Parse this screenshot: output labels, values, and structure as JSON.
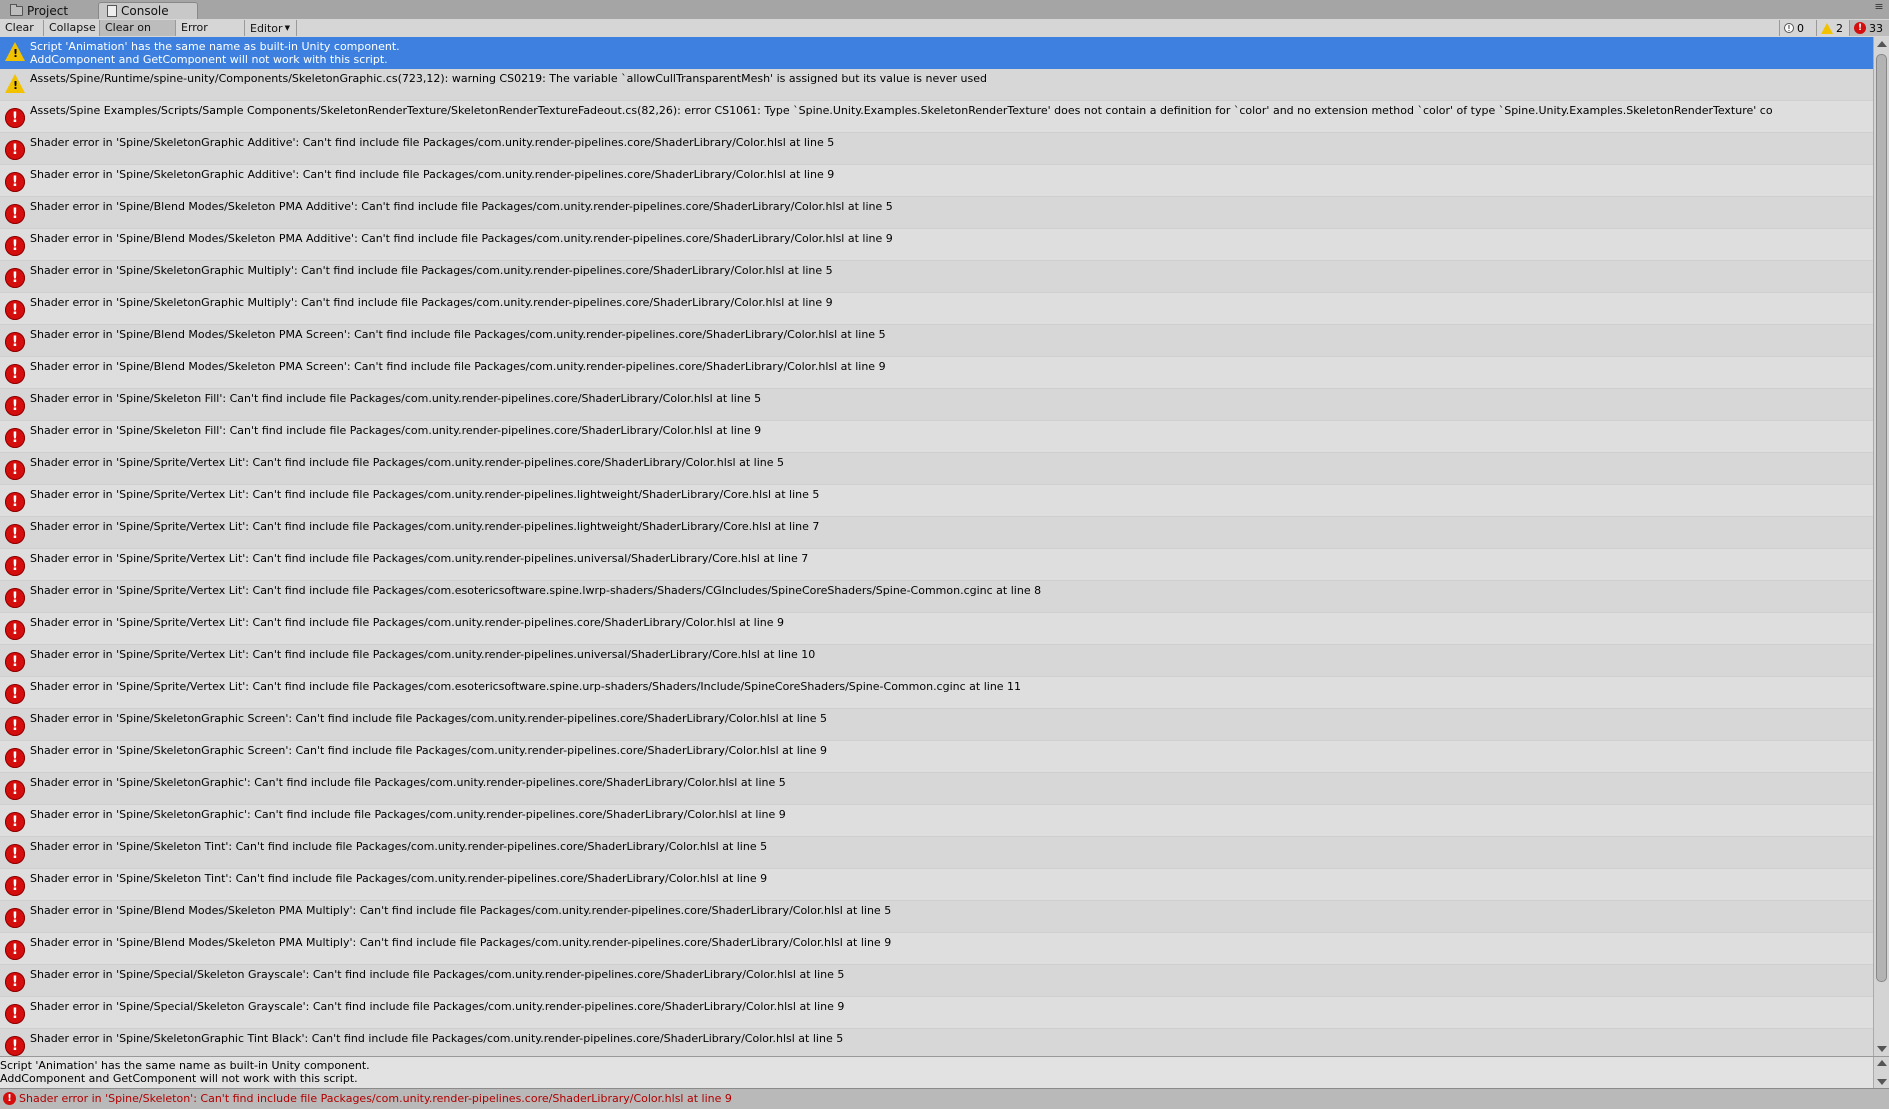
{
  "tabs": {
    "project": "Project",
    "console": "Console"
  },
  "toolbar": {
    "clear": "Clear",
    "collapse": "Collapse",
    "clear_on_play": "Clear on Play",
    "error_pause": "Error Pause",
    "editor": "Editor"
  },
  "counters": {
    "info": "0",
    "warnings": "2",
    "errors": "33"
  },
  "colors": {
    "selected_row": "#3d80df",
    "error_red": "#d40d0d",
    "warning_yellow": "#f2c200"
  },
  "entries": [
    {
      "type": "warning",
      "text": "Script 'Animation' has the same name as built-in Unity component.\nAddComponent and GetComponent will not work with this script."
    },
    {
      "type": "warning",
      "text": "Assets/Spine/Runtime/spine-unity/Components/SkeletonGraphic.cs(723,12): warning CS0219: The variable `allowCullTransparentMesh' is assigned but its value is never used"
    },
    {
      "type": "error",
      "text": "Assets/Spine Examples/Scripts/Sample Components/SkeletonRenderTexture/SkeletonRenderTextureFadeout.cs(82,26): error CS1061: Type `Spine.Unity.Examples.SkeletonRenderTexture' does not contain a definition for `color' and no extension method `color' of type `Spine.Unity.Examples.SkeletonRenderTexture' co"
    },
    {
      "type": "error",
      "text": "Shader error in 'Spine/SkeletonGraphic Additive': Can't find include file Packages/com.unity.render-pipelines.core/ShaderLibrary/Color.hlsl at line 5"
    },
    {
      "type": "error",
      "text": "Shader error in 'Spine/SkeletonGraphic Additive': Can't find include file Packages/com.unity.render-pipelines.core/ShaderLibrary/Color.hlsl at line 9"
    },
    {
      "type": "error",
      "text": "Shader error in 'Spine/Blend Modes/Skeleton PMA Additive': Can't find include file Packages/com.unity.render-pipelines.core/ShaderLibrary/Color.hlsl at line 5"
    },
    {
      "type": "error",
      "text": "Shader error in 'Spine/Blend Modes/Skeleton PMA Additive': Can't find include file Packages/com.unity.render-pipelines.core/ShaderLibrary/Color.hlsl at line 9"
    },
    {
      "type": "error",
      "text": "Shader error in 'Spine/SkeletonGraphic Multiply': Can't find include file Packages/com.unity.render-pipelines.core/ShaderLibrary/Color.hlsl at line 5"
    },
    {
      "type": "error",
      "text": "Shader error in 'Spine/SkeletonGraphic Multiply': Can't find include file Packages/com.unity.render-pipelines.core/ShaderLibrary/Color.hlsl at line 9"
    },
    {
      "type": "error",
      "text": "Shader error in 'Spine/Blend Modes/Skeleton PMA Screen': Can't find include file Packages/com.unity.render-pipelines.core/ShaderLibrary/Color.hlsl at line 5"
    },
    {
      "type": "error",
      "text": "Shader error in 'Spine/Blend Modes/Skeleton PMA Screen': Can't find include file Packages/com.unity.render-pipelines.core/ShaderLibrary/Color.hlsl at line 9"
    },
    {
      "type": "error",
      "text": "Shader error in 'Spine/Skeleton Fill': Can't find include file Packages/com.unity.render-pipelines.core/ShaderLibrary/Color.hlsl at line 5"
    },
    {
      "type": "error",
      "text": "Shader error in 'Spine/Skeleton Fill': Can't find include file Packages/com.unity.render-pipelines.core/ShaderLibrary/Color.hlsl at line 9"
    },
    {
      "type": "error",
      "text": "Shader error in 'Spine/Sprite/Vertex Lit': Can't find include file Packages/com.unity.render-pipelines.core/ShaderLibrary/Color.hlsl at line 5"
    },
    {
      "type": "error",
      "text": "Shader error in 'Spine/Sprite/Vertex Lit': Can't find include file Packages/com.unity.render-pipelines.lightweight/ShaderLibrary/Core.hlsl at line 5"
    },
    {
      "type": "error",
      "text": "Shader error in 'Spine/Sprite/Vertex Lit': Can't find include file Packages/com.unity.render-pipelines.lightweight/ShaderLibrary/Core.hlsl at line 7"
    },
    {
      "type": "error",
      "text": "Shader error in 'Spine/Sprite/Vertex Lit': Can't find include file Packages/com.unity.render-pipelines.universal/ShaderLibrary/Core.hlsl at line 7"
    },
    {
      "type": "error",
      "text": "Shader error in 'Spine/Sprite/Vertex Lit': Can't find include file Packages/com.esotericsoftware.spine.lwrp-shaders/Shaders/CGIncludes/SpineCoreShaders/Spine-Common.cginc at line 8"
    },
    {
      "type": "error",
      "text": "Shader error in 'Spine/Sprite/Vertex Lit': Can't find include file Packages/com.unity.render-pipelines.core/ShaderLibrary/Color.hlsl at line 9"
    },
    {
      "type": "error",
      "text": "Shader error in 'Spine/Sprite/Vertex Lit': Can't find include file Packages/com.unity.render-pipelines.universal/ShaderLibrary/Core.hlsl at line 10"
    },
    {
      "type": "error",
      "text": "Shader error in 'Spine/Sprite/Vertex Lit': Can't find include file Packages/com.esotericsoftware.spine.urp-shaders/Shaders/Include/SpineCoreShaders/Spine-Common.cginc at line 11"
    },
    {
      "type": "error",
      "text": "Shader error in 'Spine/SkeletonGraphic Screen': Can't find include file Packages/com.unity.render-pipelines.core/ShaderLibrary/Color.hlsl at line 5"
    },
    {
      "type": "error",
      "text": "Shader error in 'Spine/SkeletonGraphic Screen': Can't find include file Packages/com.unity.render-pipelines.core/ShaderLibrary/Color.hlsl at line 9"
    },
    {
      "type": "error",
      "text": "Shader error in 'Spine/SkeletonGraphic': Can't find include file Packages/com.unity.render-pipelines.core/ShaderLibrary/Color.hlsl at line 5"
    },
    {
      "type": "error",
      "text": "Shader error in 'Spine/SkeletonGraphic': Can't find include file Packages/com.unity.render-pipelines.core/ShaderLibrary/Color.hlsl at line 9"
    },
    {
      "type": "error",
      "text": "Shader error in 'Spine/Skeleton Tint': Can't find include file Packages/com.unity.render-pipelines.core/ShaderLibrary/Color.hlsl at line 5"
    },
    {
      "type": "error",
      "text": "Shader error in 'Spine/Skeleton Tint': Can't find include file Packages/com.unity.render-pipelines.core/ShaderLibrary/Color.hlsl at line 9"
    },
    {
      "type": "error",
      "text": "Shader error in 'Spine/Blend Modes/Skeleton PMA Multiply': Can't find include file Packages/com.unity.render-pipelines.core/ShaderLibrary/Color.hlsl at line 5"
    },
    {
      "type": "error",
      "text": "Shader error in 'Spine/Blend Modes/Skeleton PMA Multiply': Can't find include file Packages/com.unity.render-pipelines.core/ShaderLibrary/Color.hlsl at line 9"
    },
    {
      "type": "error",
      "text": "Shader error in 'Spine/Special/Skeleton Grayscale': Can't find include file Packages/com.unity.render-pipelines.core/ShaderLibrary/Color.hlsl at line 5"
    },
    {
      "type": "error",
      "text": "Shader error in 'Spine/Special/Skeleton Grayscale': Can't find include file Packages/com.unity.render-pipelines.core/ShaderLibrary/Color.hlsl at line 9"
    },
    {
      "type": "error",
      "text": "Shader error in 'Spine/SkeletonGraphic Tint Black': Can't find include file Packages/com.unity.render-pipelines.core/ShaderLibrary/Color.hlsl at line 5"
    }
  ],
  "selected_index": 0,
  "detail": "Script 'Animation' has the same name as built-in Unity component.\nAddComponent and GetComponent will not work with this script.",
  "status": "Shader error in 'Spine/Skeleton': Can't find include file Packages/com.unity.render-pipelines.core/ShaderLibrary/Color.hlsl at line 9"
}
